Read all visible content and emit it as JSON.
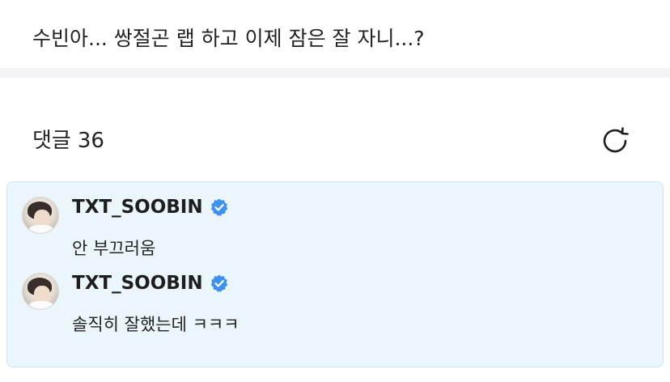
{
  "post": {
    "text": "수빈아... 쌍절곤 랩 하고 이제 잠은 잘 자니...?"
  },
  "comments_header": {
    "label": "댓글",
    "count": "36",
    "refresh_icon": "refresh-icon"
  },
  "comments": [
    {
      "username": "TXT_SOOBIN",
      "verified": true,
      "text": "안 부끄러움"
    },
    {
      "username": "TXT_SOOBIN",
      "verified": true,
      "text": "솔직히 잘했는데 ㅋㅋㅋ"
    }
  ],
  "colors": {
    "panel_bg": "#ebf6fc",
    "verified_blue": "#3d91f0",
    "divider": "#f3f3f5"
  }
}
